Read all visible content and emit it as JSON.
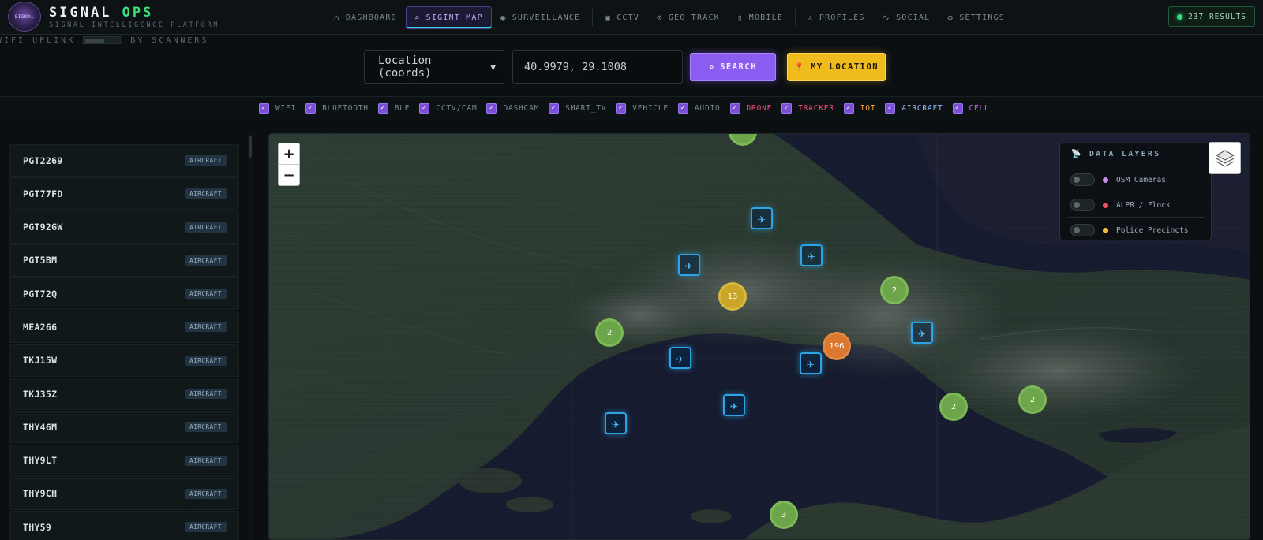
{
  "brand": {
    "emblem": "SIGNAL",
    "title_main": "SIGNAL",
    "title_accent": "OPS",
    "subtitle": "SIGNAL INTELLIGENCE PLATFORM"
  },
  "nav": {
    "items": [
      {
        "label": "DASHBOARD",
        "icon": "home-icon"
      },
      {
        "label": "SIGINT MAP",
        "icon": "search-icon",
        "active": true
      },
      {
        "label": "SURVEILLANCE",
        "icon": "eye-icon"
      },
      {
        "label": "CCTV",
        "icon": "camera-icon"
      },
      {
        "label": "GEO TRACK",
        "icon": "pin-icon"
      },
      {
        "label": "MOBILE",
        "icon": "phone-icon"
      },
      {
        "label": "PROFILES",
        "icon": "user-icon"
      },
      {
        "label": "SOCIAL",
        "icon": "activity-icon"
      },
      {
        "label": "SETTINGS",
        "icon": "gear-icon"
      }
    ],
    "results": "237 RESULTS"
  },
  "uplink": {
    "left_label": "WIFI UPLINK",
    "right_label": "BY SCANNERS"
  },
  "search": {
    "mode": "Location (coords)",
    "coords_value": "40.9979, 29.1008",
    "search_label": "SEARCH",
    "my_location_label": "MY LOCATION"
  },
  "filters": [
    {
      "label": "WIFI",
      "color": "#7d8a90"
    },
    {
      "label": "BLUETOOTH",
      "color": "#7d8a90"
    },
    {
      "label": "BLE",
      "color": "#7d8a90"
    },
    {
      "label": "CCTV/CAM",
      "color": "#7d8a90"
    },
    {
      "label": "DASHCAM",
      "color": "#7d8a90"
    },
    {
      "label": "SMART_TV",
      "color": "#7d8a90"
    },
    {
      "label": "VEHICLE",
      "color": "#7d8a90"
    },
    {
      "label": "AUDIO",
      "color": "#7d8a90"
    },
    {
      "label": "DRONE",
      "color": "#e8507a"
    },
    {
      "label": "TRACKER",
      "color": "#e8507a"
    },
    {
      "label": "IOT",
      "color": "#f0a43a"
    },
    {
      "label": "AIRCRAFT",
      "color": "#8fb6ff"
    },
    {
      "label": "CELL",
      "color": "#d657e8"
    }
  ],
  "devices": [
    {
      "callsign": "PGT2269",
      "type": "AIRCRAFT"
    },
    {
      "callsign": "PGT77FD",
      "type": "AIRCRAFT"
    },
    {
      "callsign": "PGT92GW",
      "type": "AIRCRAFT"
    },
    {
      "callsign": "PGT5BM",
      "type": "AIRCRAFT"
    },
    {
      "callsign": "PGT72Q",
      "type": "AIRCRAFT"
    },
    {
      "callsign": "MEA266",
      "type": "AIRCRAFT"
    },
    {
      "callsign": "TKJ15W",
      "type": "AIRCRAFT"
    },
    {
      "callsign": "TKJ35Z",
      "type": "AIRCRAFT"
    },
    {
      "callsign": "THY46M",
      "type": "AIRCRAFT"
    },
    {
      "callsign": "THY9LT",
      "type": "AIRCRAFT"
    },
    {
      "callsign": "THY9CH",
      "type": "AIRCRAFT"
    },
    {
      "callsign": "THY59",
      "type": "AIRCRAFT"
    }
  ],
  "map": {
    "zoom_in": "+",
    "zoom_out": "−",
    "layers_title": "DATA LAYERS",
    "layers": [
      {
        "label": "OSM Cameras",
        "color": "#c58cf0"
      },
      {
        "label": "ALPR / Flock",
        "color": "#e8506a"
      },
      {
        "label": "Police Precincts",
        "color": "#f0c23a"
      }
    ],
    "clusters": [
      "2",
      "13",
      "2",
      "196",
      "2",
      "2",
      "3"
    ]
  }
}
